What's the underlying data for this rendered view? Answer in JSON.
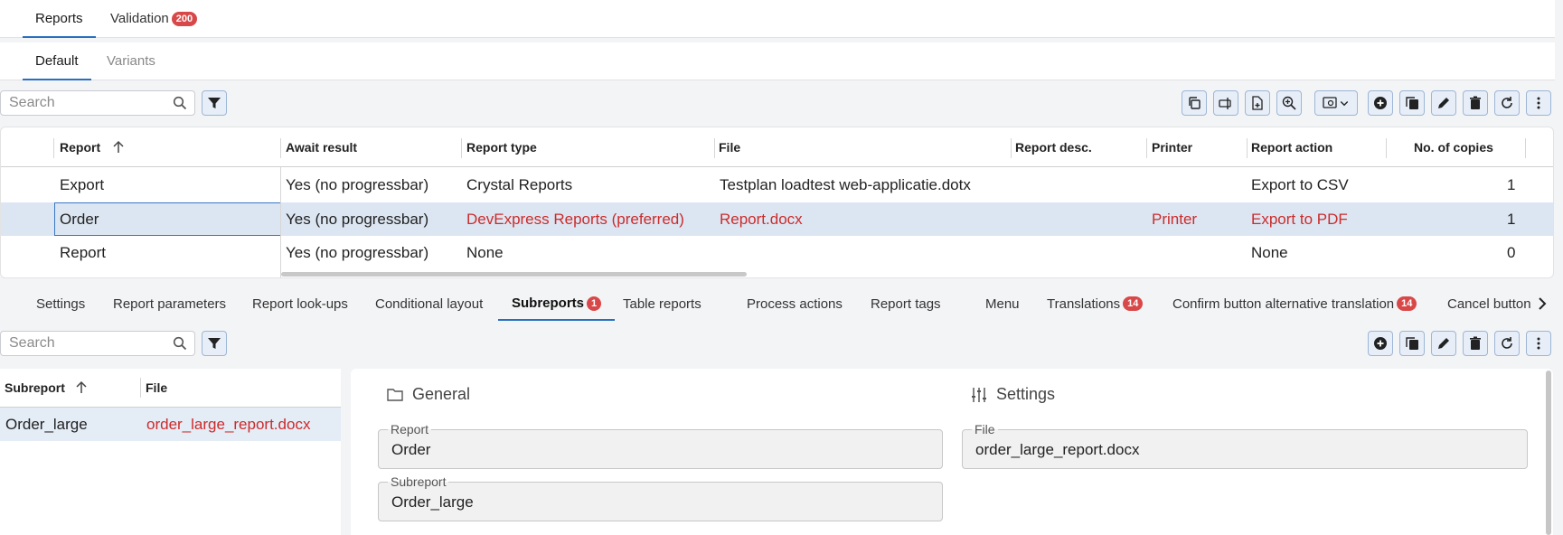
{
  "top_tabs": [
    {
      "label": "Reports"
    },
    {
      "label": "Validation",
      "badge": "200"
    }
  ],
  "sub_tabs": [
    {
      "label": "Default"
    },
    {
      "label": "Variants"
    }
  ],
  "search": {
    "placeholder": "Search"
  },
  "toolbar_icons": [
    "copy-icon",
    "rename-icon",
    "add-file-icon",
    "zoom-plus-icon",
    "preview-dropdown-icon",
    "add-icon",
    "duplicate-icon",
    "edit-icon",
    "delete-icon",
    "refresh-icon",
    "more-icon"
  ],
  "grid": {
    "columns": [
      "Report",
      "Await result",
      "Report type",
      "File",
      "Report desc.",
      "Printer",
      "Report action",
      "No. of copies"
    ],
    "rows": [
      {
        "report": "Export",
        "await": "Yes (no progressbar)",
        "type": "Crystal Reports",
        "file": "Testplan loadtest web-applicatie.dotx",
        "desc": "",
        "printer": "",
        "action": "Export to CSV",
        "copies": "1"
      },
      {
        "report": "Order",
        "await": "Yes (no progressbar)",
        "type": "DevExpress Reports (preferred)",
        "file": "Report.docx",
        "desc": "",
        "printer": "Printer",
        "action": "Export to PDF",
        "copies": "1"
      },
      {
        "report": "Report",
        "await": "Yes (no progressbar)",
        "type": "None",
        "file": "",
        "desc": "",
        "printer": "",
        "action": "None",
        "copies": "0"
      }
    ]
  },
  "detail_tabs": [
    {
      "label": "Settings"
    },
    {
      "label": "Report parameters"
    },
    {
      "label": "Report look-ups"
    },
    {
      "label": "Conditional layout"
    },
    {
      "label": "Subreports",
      "badge": "1"
    },
    {
      "label": "Table reports"
    },
    {
      "label": "Process actions"
    },
    {
      "label": "Report tags"
    },
    {
      "label": "Menu"
    },
    {
      "label": "Translations",
      "badge": "14"
    },
    {
      "label": "Confirm button alternative translation",
      "badge": "14"
    },
    {
      "label": "Cancel button"
    }
  ],
  "subgrid": {
    "columns": [
      "Subreport",
      "File"
    ],
    "rows": [
      {
        "subreport": "Order_large",
        "file": "order_large_report.docx"
      }
    ]
  },
  "form": {
    "general_title": "General",
    "settings_title": "Settings",
    "report_label": "Report",
    "report_value": "Order",
    "subreport_label": "Subreport",
    "subreport_value": "Order_large",
    "file_label": "File",
    "file_value": "order_large_report.docx"
  },
  "colors": {
    "accent": "#2a6fbf",
    "badge": "#d94848",
    "error_text": "#cc2b2b",
    "selected_row": "#dce6f2"
  }
}
